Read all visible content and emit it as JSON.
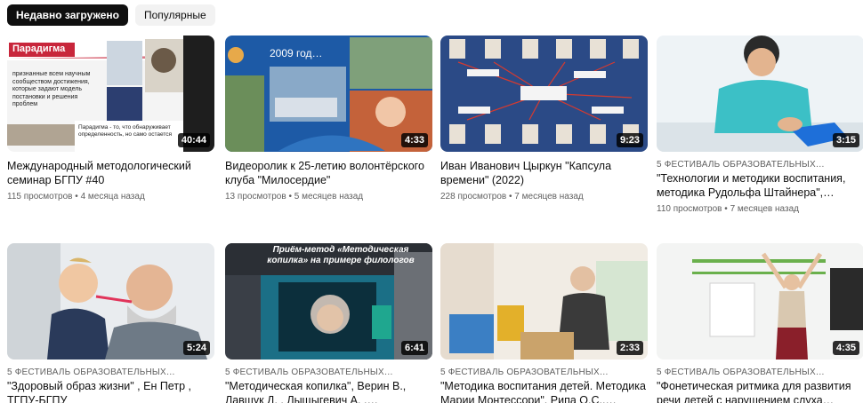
{
  "tabs": [
    {
      "label": "Недавно загружено",
      "active": true
    },
    {
      "label": "Популярные",
      "active": false
    }
  ],
  "videos": [
    {
      "title": "Международный методологический семинар БГПУ #40",
      "overline": "",
      "views": "115 просмотров",
      "age": "4 месяца назад",
      "duration": "40:44",
      "thumb_text": {
        "heading": "Парадигма",
        "body": "признанные всем научным сообществом достижения, которые задают модель постановки и решения проблем",
        "quote": "Парадигма - то, что обнаруживает определенность, но само остается"
      }
    },
    {
      "title": "Видеоролик к 25-летию волонтёрского клуба \"Милосердие\"",
      "overline": "",
      "views": "13 просмотров",
      "age": "5 месяцев назад",
      "duration": "4:33",
      "thumb_text": {
        "heading": "2009 год…"
      }
    },
    {
      "title": "Иван Иванович Цыркун \"Капсула времени\" (2022)",
      "overline": "",
      "views": "228 просмотров",
      "age": "7 месяцев назад",
      "duration": "9:23",
      "thumb_text": {}
    },
    {
      "title": "\"Технологии и методики воспитания, методика Рудольфа Штайнера\",…",
      "overline": "5 ФЕСТИВАЛЬ ОБРАЗОВАТЕЛЬНЫХ…",
      "views": "110 просмотров",
      "age": "7 месяцев назад",
      "duration": "3:15",
      "thumb_text": {}
    },
    {
      "title": "\"Здоровый образ жизни\" , Ен Петр , ТГПУ-БГПУ",
      "overline": "5 ФЕСТИВАЛЬ ОБРАЗОВАТЕЛЬНЫХ…",
      "views": "",
      "age": "",
      "duration": "5:24",
      "thumb_text": {}
    },
    {
      "title": "\"Методическая копилка\", Верин В., Лавшук Д. , Лыщыгевич А. , Липницкая…",
      "overline": "5 ФЕСТИВАЛЬ ОБРАЗОВАТЕЛЬНЫХ…",
      "views": "",
      "age": "",
      "duration": "6:41",
      "thumb_text": {
        "heading": "Приём-метод «Методическая копилка» на примере филологов"
      }
    },
    {
      "title": "\"Методика воспитания детей. Методика Марии Монтессори\", Рипа О.С.,…",
      "overline": "5 ФЕСТИВАЛЬ ОБРАЗОВАТЕЛЬНЫХ…",
      "views": "",
      "age": "",
      "duration": "2:33",
      "thumb_text": {}
    },
    {
      "title": "\"Фонетическая ритмика для развития речи детей с нарушением слуха раннего…",
      "overline": "5 ФЕСТИВАЛЬ ОБРАЗОВАТЕЛЬНЫХ…",
      "views": "",
      "age": "",
      "duration": "4:35",
      "thumb_text": {}
    }
  ],
  "colors": {
    "accent_dark": "#0f0f0f",
    "chip_idle": "#f2f2f2",
    "meta_text": "#606060"
  }
}
